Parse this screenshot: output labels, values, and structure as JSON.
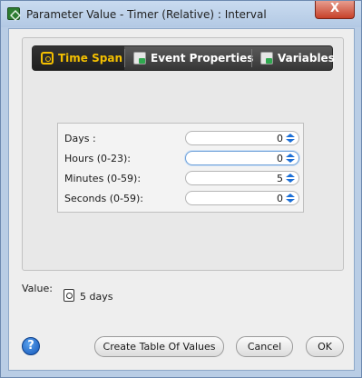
{
  "window": {
    "title": "Parameter Value - Timer (Relative) : Interval",
    "close_glyph": "X"
  },
  "tabs": [
    {
      "label": "Time Span",
      "icon": "clock-icon",
      "active": true
    },
    {
      "label": "Event Properties",
      "icon": "properties-icon",
      "active": false
    },
    {
      "label": "Variables",
      "icon": "properties-icon",
      "active": false
    }
  ],
  "fields": [
    {
      "label": "Days :",
      "value": "0"
    },
    {
      "label": "Hours (0-23):",
      "value": "0"
    },
    {
      "label": "Minutes (0-59):",
      "value": "5"
    },
    {
      "label": "Seconds (0-59):",
      "value": "0"
    }
  ],
  "value": {
    "label": "Value:",
    "text": "5 days"
  },
  "buttons": {
    "help": "?",
    "create_table": "Create Table Of Values",
    "cancel": "Cancel",
    "ok": "OK"
  },
  "colors": {
    "active_tab_text": "#f4c000",
    "tab_bar": "#363636",
    "spinner_arrow": "#1c6fd6"
  }
}
